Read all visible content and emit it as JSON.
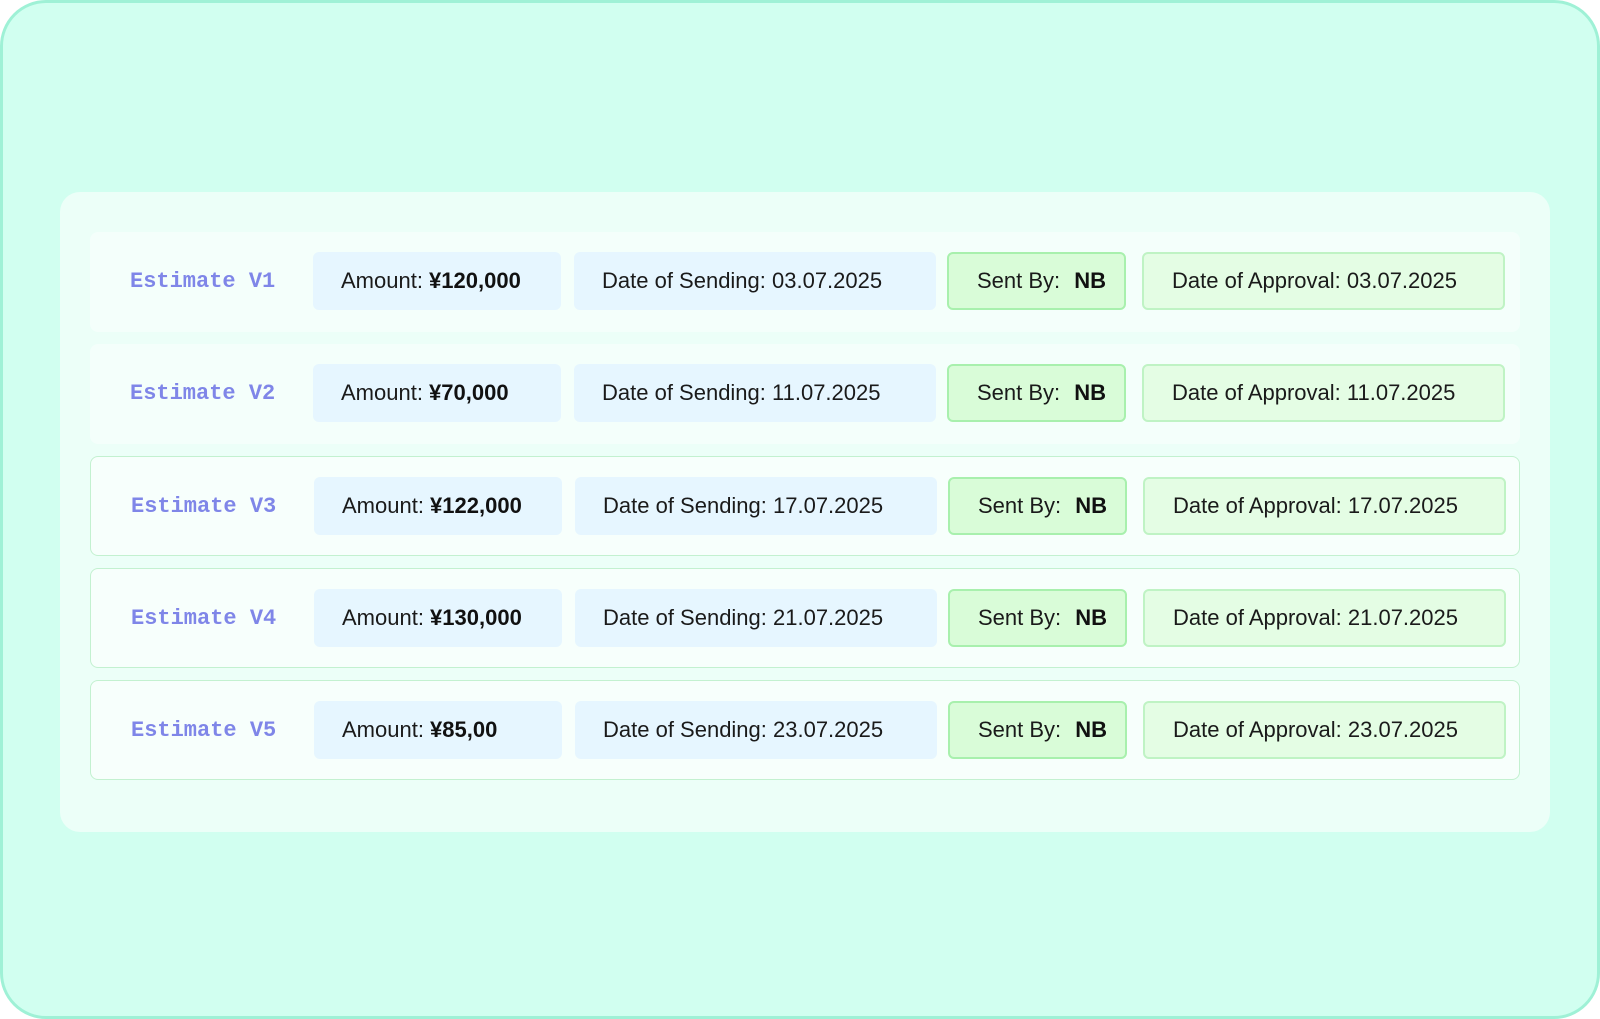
{
  "colors": {
    "frame_bg": "#d1fff0",
    "frame_border": "#9ff1d6",
    "label": "#7f86e8",
    "amount_chip": "#e6f6ff",
    "sent_by_chip": "#d9fcd8",
    "approval_chip": "#e4fde4"
  },
  "estimates": [
    {
      "label": "Estimate V1",
      "amount_label": "Amount: ",
      "amount": "¥120,000",
      "sending": "Date of Sending: 03.07.2025",
      "sent_by_label": "Sent By: ",
      "sent_by": "NB",
      "approval": "Date of Approval: 03.07.2025"
    },
    {
      "label": "Estimate V2",
      "amount_label": "Amount: ",
      "amount": "¥70,000",
      "sending": "Date of Sending: 11.07.2025",
      "sent_by_label": "Sent By: ",
      "sent_by": "NB",
      "approval": "Date of Approval: 11.07.2025"
    },
    {
      "label": "Estimate V3",
      "amount_label": "Amount: ",
      "amount": "¥122,000",
      "sending": "Date of Sending: 17.07.2025",
      "sent_by_label": "Sent By: ",
      "sent_by": "NB",
      "approval": "Date of Approval: 17.07.2025"
    },
    {
      "label": "Estimate V4",
      "amount_label": "Amount: ",
      "amount": "¥130,000",
      "sending": "Date of Sending: 21.07.2025",
      "sent_by_label": "Sent By: ",
      "sent_by": "NB",
      "approval": "Date of Approval: 21.07.2025"
    },
    {
      "label": "Estimate V5",
      "amount_label": "Amount: ",
      "amount": "¥85,00",
      "sending": "Date of Sending: 23.07.2025",
      "sent_by_label": "Sent By: ",
      "sent_by": "NB",
      "approval": "Date of Approval: 23.07.2025"
    }
  ]
}
